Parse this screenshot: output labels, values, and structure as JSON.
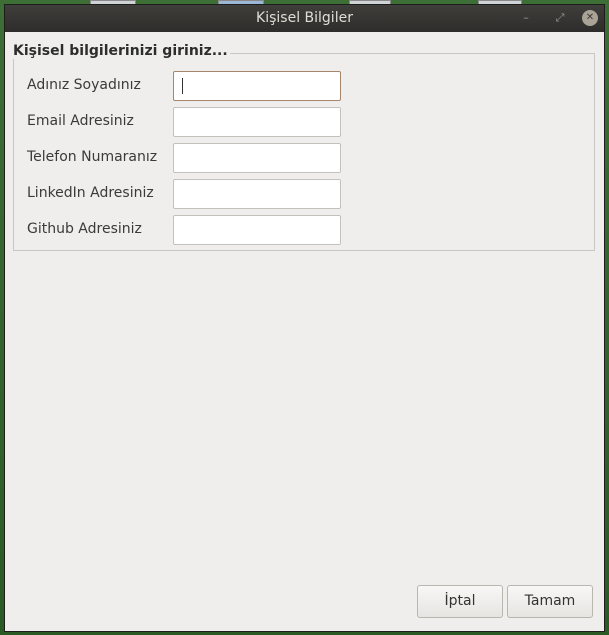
{
  "window": {
    "title": "Kişisel Bilgiler",
    "controls": {
      "minimize_icon": "minimize-icon",
      "maximize_icon": "maximize-icon",
      "close_icon": "close-icon"
    }
  },
  "form": {
    "group_title": "Kişisel bilgilerinizi giriniz...",
    "fields": [
      {
        "label": "Adınız Soyadınız",
        "value": "",
        "focused": true
      },
      {
        "label": "Email Adresiniz",
        "value": ""
      },
      {
        "label": "Telefon Numaranız",
        "value": ""
      },
      {
        "label": "LinkedIn Adresiniz",
        "value": ""
      },
      {
        "label": "Github Adresiniz",
        "value": ""
      }
    ]
  },
  "buttons": {
    "cancel_label": "İptal",
    "ok_label": "Tamam"
  },
  "colors": {
    "titlebar": "#2e2d2b",
    "focus_border": "#a4866a",
    "desktop": "#2f6b2c"
  }
}
